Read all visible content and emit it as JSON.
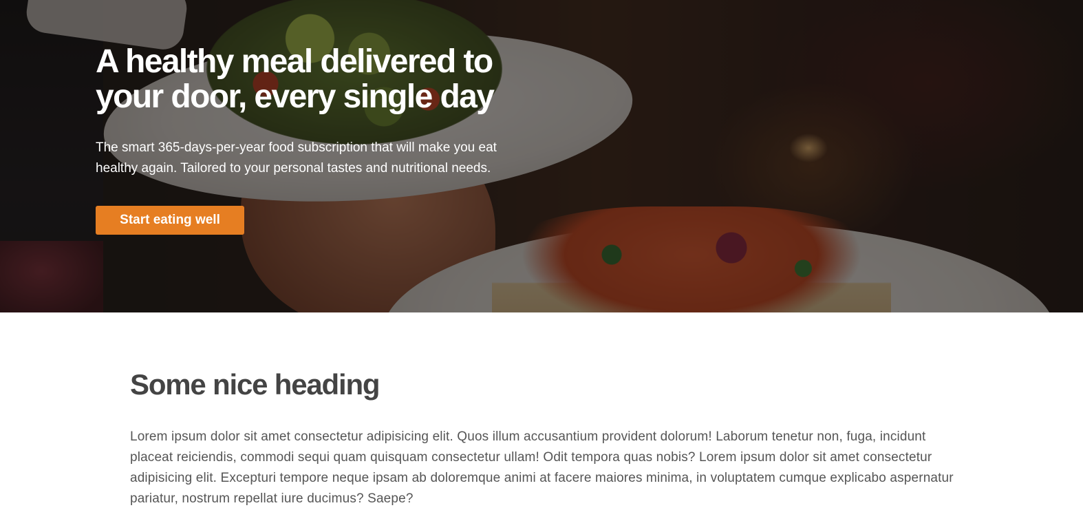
{
  "hero": {
    "title": "A healthy meal delivered to your door, every single day",
    "text": "The smart 365-days-per-year food subscription that will make you eat healthy again. Tailored to your personal tastes and nutritional needs.",
    "button_label": "Start eating well",
    "button_color": "#e67e22"
  },
  "section": {
    "heading": "Some nice heading",
    "text": "Lorem ipsum dolor sit amet consectetur adipisicing elit. Quos illum accusantium provident dolorum! Laborum tenetur non, fuga, incidunt placeat reiciendis, commodi sequi quam quisquam consectetur ullam! Odit tempora quas nobis? Lorem ipsum dolor sit amet consectetur adipisicing elit. Excepturi tempore neque ipsam ab doloremque animi at facere maiores minima, in voluptatem cumque explicabo aspernatur pariatur, nostrum repellat iure ducimus? Saepe?"
  }
}
